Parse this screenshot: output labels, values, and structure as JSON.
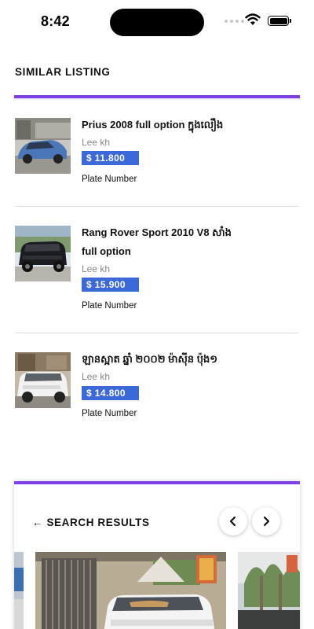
{
  "status_bar": {
    "time": "8:42"
  },
  "similar": {
    "title": "SIMILAR LISTING",
    "items": [
      {
        "title_line1": "Prius 2008 full option ក្នុងលឿង",
        "title_line2": "",
        "owner": "Lee kh",
        "price": "$ 11.800",
        "plate_label": "Plate Number",
        "thumb_icon": "blue-prius-photo"
      },
      {
        "title_line1": "Rang Rover Sport 2010 V8 សាំង",
        "title_line2": "full option",
        "owner": "Lee kh",
        "price": "$ 15.900",
        "plate_label": "Plate Number",
        "thumb_icon": "black-range-rover-photo"
      },
      {
        "title_line1": "ឡានស្អាត ឆ្នាំ ២០០២ ម៉ាស៊ីន ប៉ុង១",
        "title_line2": "",
        "owner": "Lee kh",
        "price": "$ 14.800",
        "plate_label": "Plate Number",
        "thumb_icon": "white-suv-photo"
      }
    ]
  },
  "search_results": {
    "title": "← SEARCH RESULTS",
    "prev_label": "‹",
    "next_label": "›"
  },
  "colors": {
    "accent": "#7b3fe4",
    "price_badge": "#3b69d9"
  }
}
